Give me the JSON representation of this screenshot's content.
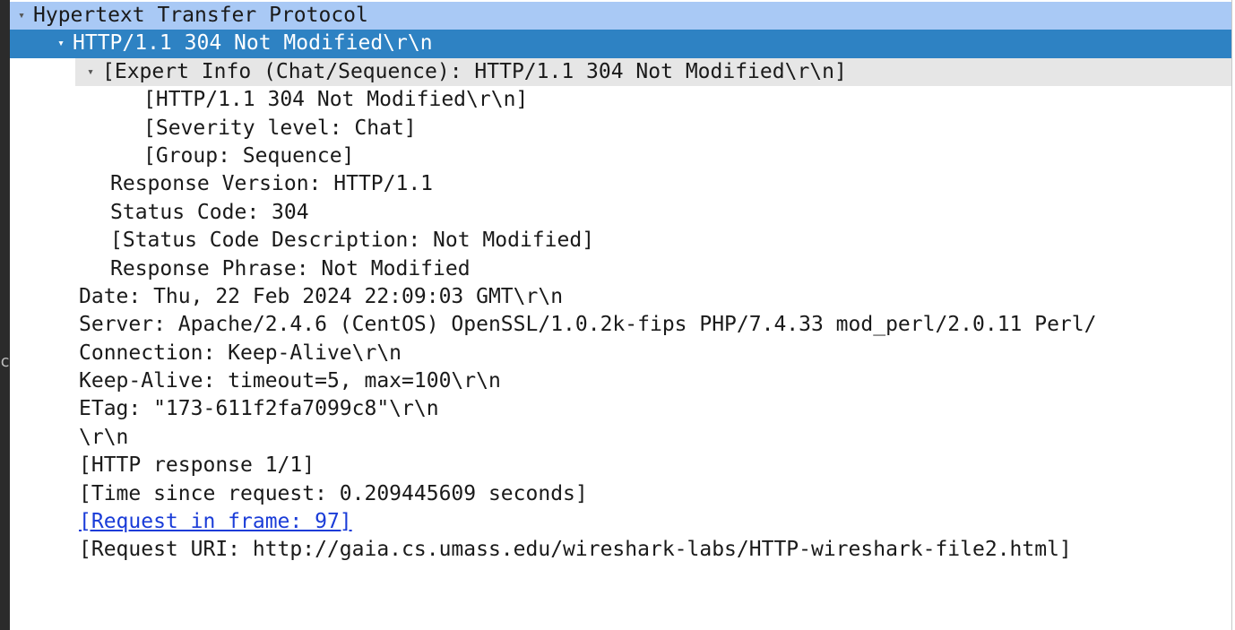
{
  "left_strip": {
    "clipped_char": "c"
  },
  "tree": {
    "expand_icon": "▾",
    "rows": [
      {
        "text": "Hypertext Transfer Protocol"
      },
      {
        "text": "HTTP/1.1 304 Not Modified\\r\\n"
      },
      {
        "text": "[Expert Info (Chat/Sequence): HTTP/1.1 304 Not Modified\\r\\n]"
      },
      {
        "text": "[HTTP/1.1 304 Not Modified\\r\\n]"
      },
      {
        "text": "[Severity level: Chat]"
      },
      {
        "text": "[Group: Sequence]"
      },
      {
        "text": "Response Version: HTTP/1.1"
      },
      {
        "text": "Status Code: 304"
      },
      {
        "text": "[Status Code Description: Not Modified]"
      },
      {
        "text": "Response Phrase: Not Modified"
      },
      {
        "text": "Date: Thu, 22 Feb 2024 22:09:03 GMT\\r\\n"
      },
      {
        "text": "Server: Apache/2.4.6 (CentOS) OpenSSL/1.0.2k-fips PHP/7.4.33 mod_perl/2.0.11 Perl/"
      },
      {
        "text": "Connection: Keep-Alive\\r\\n"
      },
      {
        "text": "Keep-Alive: timeout=5, max=100\\r\\n"
      },
      {
        "text": "ETag: \"173-611f2fa7099c8\"\\r\\n"
      },
      {
        "text": "\\r\\n"
      },
      {
        "text": "[HTTP response 1/1]"
      },
      {
        "text": "[Time since request: 0.209445609 seconds]"
      },
      {
        "text": "[Request in frame: 97]"
      },
      {
        "text": "[Request URI: http://gaia.cs.umass.edu/wireshark-labs/HTTP-wireshark-file2.html]"
      }
    ]
  },
  "colors": {
    "top_row_highlight": "#a9c9f5",
    "selected_row": "#2e82c3",
    "hover_row": "#e6e6e6",
    "link": "#1a3cd8"
  }
}
